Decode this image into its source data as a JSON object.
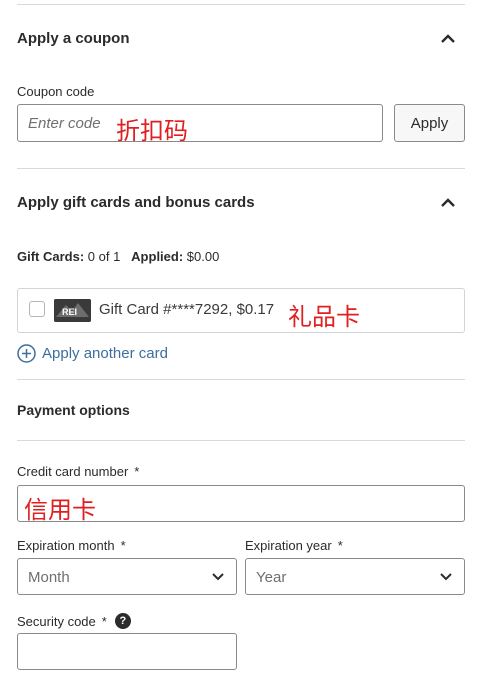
{
  "coupon": {
    "title": "Apply a coupon",
    "field_label": "Coupon code",
    "placeholder": "Enter code",
    "annotation": "折扣码",
    "apply_label": "Apply"
  },
  "gift": {
    "title": "Apply gift cards and bonus cards",
    "summary_cards_label": "Gift Cards:",
    "summary_cards_value": "0 of 1",
    "summary_applied_label": "Applied:",
    "summary_applied_value": "$0.00",
    "card_text": "Gift Card #****7292, $0.17",
    "card_logo_text": "REI",
    "annotation": "礼品卡",
    "apply_another": "Apply another card"
  },
  "payment": {
    "title": "Payment options",
    "cc_label": "Credit card number",
    "cc_annotation": "信用卡",
    "exp_month_label": "Expiration month",
    "exp_month_value": "Month",
    "exp_year_label": "Expiration year",
    "exp_year_value": "Year",
    "security_label": "Security code",
    "required_mark": "*",
    "help_glyph": "?"
  },
  "colors": {
    "link": "#3d6e9e",
    "annotation": "#e02020",
    "border": "#8a8a8a"
  }
}
